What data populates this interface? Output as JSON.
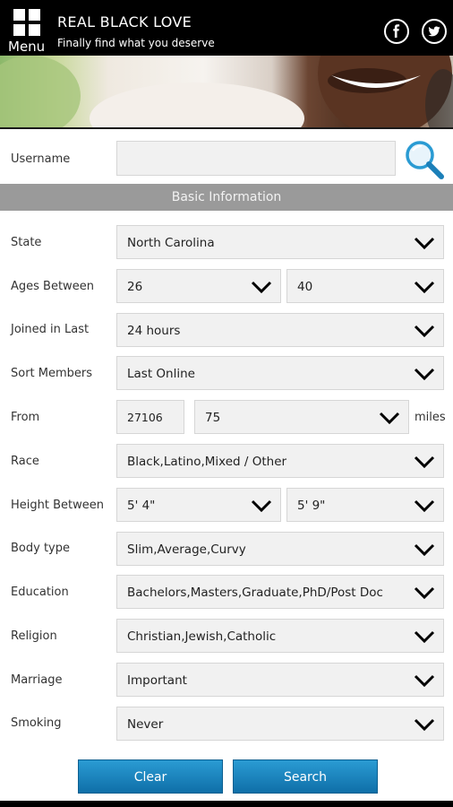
{
  "header": {
    "menu_label": "Menu",
    "title": "REAL BLACK LOVE",
    "subtitle": "Finally find what you deserve"
  },
  "search": {
    "username_label": "Username",
    "username_value": ""
  },
  "section_title": "Basic Information",
  "form": {
    "state": {
      "label": "State",
      "value": "North Carolina"
    },
    "ages": {
      "label": "Ages Between",
      "min": "26",
      "max": "40"
    },
    "joined": {
      "label": "Joined in Last",
      "value": "24 hours"
    },
    "sort": {
      "label": "Sort Members",
      "value": "Last Online"
    },
    "from": {
      "label": "From",
      "zip": "27106",
      "distance": "75",
      "unit": "miles"
    },
    "race": {
      "label": "Race",
      "value": "Black,Latino,Mixed / Other"
    },
    "height": {
      "label": "Height Between",
      "min": "5' 4\"",
      "max": "5' 9\""
    },
    "body": {
      "label": "Body type",
      "value": "Slim,Average,Curvy"
    },
    "education": {
      "label": "Education",
      "value": "Bachelors,Masters,Graduate,PhD/Post Doc"
    },
    "religion": {
      "label": "Religion",
      "value": "Christian,Jewish,Catholic"
    },
    "marriage": {
      "label": "Marriage",
      "value": "Important"
    },
    "smoking": {
      "label": "Smoking",
      "value": "Never"
    }
  },
  "buttons": {
    "clear": "Clear",
    "search": "Search"
  },
  "colors": {
    "header_bg": "#000000",
    "section_bar": "#9a9a9a",
    "button_blue": "#1a85c0",
    "search_icon": "#2a9bd3"
  }
}
